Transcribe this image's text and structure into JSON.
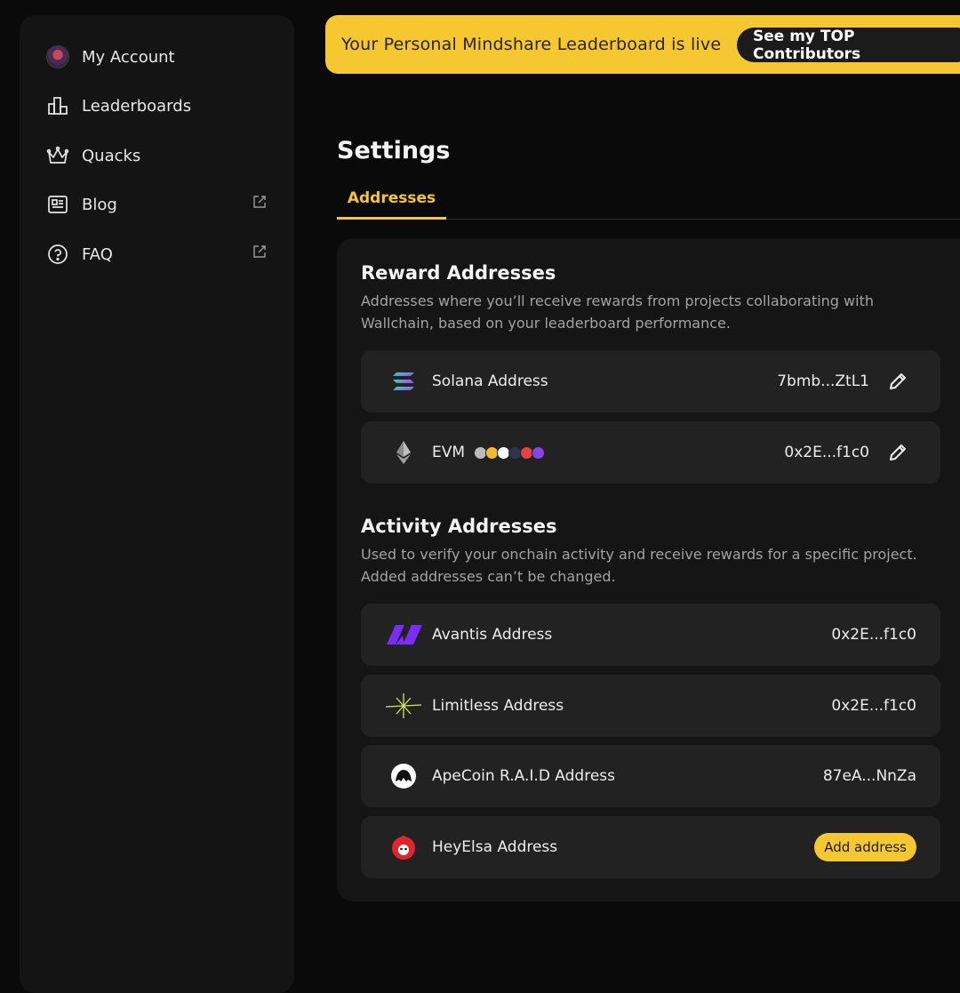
{
  "sidebar": {
    "items": [
      {
        "label": "My Account",
        "icon": "avatar"
      },
      {
        "label": "Leaderboards",
        "icon": "bar-chart-icon"
      },
      {
        "label": "Quacks",
        "icon": "crown-icon"
      },
      {
        "label": "Blog",
        "icon": "newspaper-icon",
        "external": true
      },
      {
        "label": "FAQ",
        "icon": "question-circle-icon",
        "external": true
      }
    ]
  },
  "banner": {
    "text": "Your Personal Mindshare Leaderboard is live",
    "button_label": "See my TOP Contributors"
  },
  "page": {
    "title": "Settings",
    "active_tab": "Addresses"
  },
  "reward": {
    "title": "Reward Addresses",
    "description": "Addresses where you’ll receive rewards from projects collaborating with Wallchain, based on your leaderboard performance.",
    "rows": [
      {
        "label": "Solana Address",
        "value": "7bmb...ZtL1",
        "icon": "solana-icon"
      },
      {
        "label": "EVM",
        "value": "0x2E...f1c0",
        "icon": "ethereum-icon"
      }
    ]
  },
  "activity": {
    "title": "Activity Addresses",
    "description": "Used to verify your onchain activity and receive rewards for a specific project. Added addresses can’t be changed.",
    "rows": [
      {
        "label": "Avantis Address",
        "value": "0x2E...f1c0",
        "icon": "avantis-icon"
      },
      {
        "label": "Limitless Address",
        "value": "0x2E...f1c0",
        "icon": "limitless-icon"
      },
      {
        "label": "ApeCoin R.A.I.D Address",
        "value": "87eA...NnZa",
        "icon": "apecoin-icon"
      },
      {
        "label": "HeyElsa Address",
        "button_label": "Add address",
        "icon": "heyelsa-icon"
      }
    ]
  },
  "colors": {
    "accent": "#f5c831",
    "background": "#0a0a0a",
    "card": "#151515",
    "row": "#222222"
  }
}
